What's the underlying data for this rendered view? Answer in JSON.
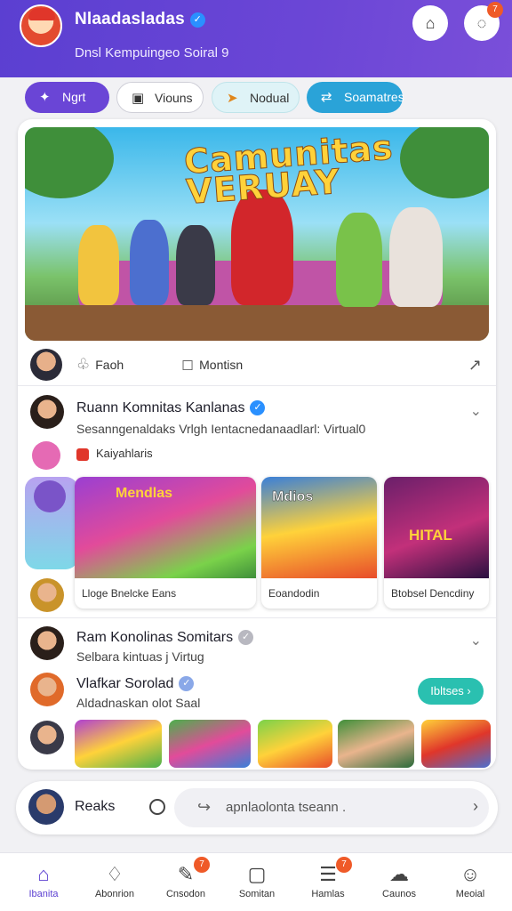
{
  "header": {
    "title": "Nlaadasladas",
    "subtitle": "Dnsl Kempuingeo Soiral 9",
    "cart_badge": "",
    "chat_badge": "7"
  },
  "chips": [
    {
      "label": "Ngrt",
      "icon": "sparkle-icon"
    },
    {
      "label": "Viouns",
      "icon": "video-icon"
    },
    {
      "label": "Nodual",
      "icon": "arrow-icon"
    },
    {
      "label": "Soamatres",
      "icon": "share-icon"
    }
  ],
  "feed": {
    "hero_title": "Camunitas VERUAY",
    "actions": {
      "react_label": "Faoh",
      "comment_label": "Montisn"
    },
    "post1": {
      "title": "Ruann Komnitas Kanlanas",
      "subtitle": "Sesanngenaldaks Vrlgh Ientacnedanaadlarl: Virtual0",
      "tag": "Kaiyahlaris"
    },
    "cards": [
      {
        "caption": "Lloge Bnelcke Eans",
        "title_art": "Mendlas"
      },
      {
        "caption": "Eoandodin",
        "title_art": "Mdios"
      },
      {
        "caption": "Btobsel Dencdiny",
        "title_art": "HITAL"
      }
    ],
    "post2": {
      "title": "Ram Konolinas Somitars",
      "subtitle": "Selbara kintuas j Virtug"
    },
    "post3": {
      "title": "Vlafkar Sorolad",
      "subtitle": "Aldadnaskan olot Saal",
      "button_label": "Ibltses"
    }
  },
  "search_bar": {
    "label": "Reaks",
    "placeholder": "apnlaolonta tseann ."
  },
  "tabs": [
    {
      "label": "Ibanita",
      "icon": "home-icon",
      "badge": ""
    },
    {
      "label": "Abonrion",
      "icon": "bell-icon",
      "badge": ""
    },
    {
      "label": "Cnsodon",
      "icon": "feather-icon",
      "badge": "7"
    },
    {
      "label": "Somitan",
      "icon": "square-icon",
      "badge": ""
    },
    {
      "label": "Hamlas",
      "icon": "message-icon",
      "badge": "7"
    },
    {
      "label": "Caunos",
      "icon": "group-icon",
      "badge": ""
    },
    {
      "label": "Meoial",
      "icon": "user-icon",
      "badge": ""
    }
  ]
}
